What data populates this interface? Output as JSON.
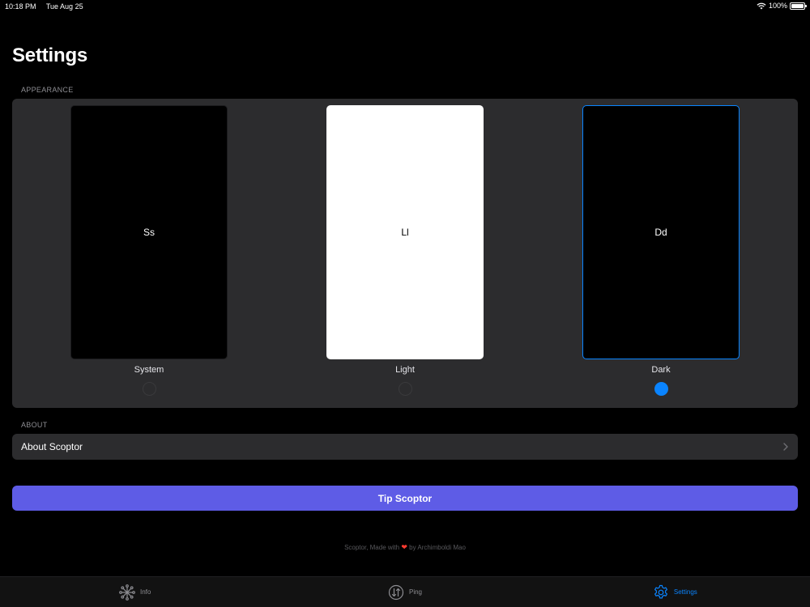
{
  "status_bar": {
    "time": "10:18 PM",
    "date": "Tue Aug 25",
    "battery": "100%",
    "icons": [
      "wifi-icon",
      "battery-icon"
    ]
  },
  "page": {
    "title": "Settings"
  },
  "appearance": {
    "header": "APPEARANCE",
    "selected": "Dark",
    "options": [
      {
        "preview_text": "Ss",
        "label": "System",
        "selected": false
      },
      {
        "preview_text": "Ll",
        "label": "Light",
        "selected": false
      },
      {
        "preview_text": "Dd",
        "label": "Dark",
        "selected": true
      }
    ]
  },
  "about": {
    "header": "ABOUT",
    "row_label": "About Scoptor",
    "icon": "chevron-right-icon"
  },
  "tip": {
    "label": "Tip Scoptor"
  },
  "footer": {
    "prefix": "Scoptor, Made with",
    "suffix": "by Archimboldi Mao",
    "icon": "heart-icon"
  },
  "tab_bar": {
    "tabs": [
      {
        "label": "Info",
        "icon": "asterisk-icon",
        "active": false
      },
      {
        "label": "Ping",
        "icon": "arrows-updown-icon",
        "active": false
      },
      {
        "label": "Settings",
        "icon": "gear-icon",
        "active": true
      }
    ]
  },
  "colors": {
    "accent": "#0a84ff",
    "tip_button": "#5e5ce6",
    "card_background": "#2c2c2e",
    "heart": "#ff3b30"
  }
}
